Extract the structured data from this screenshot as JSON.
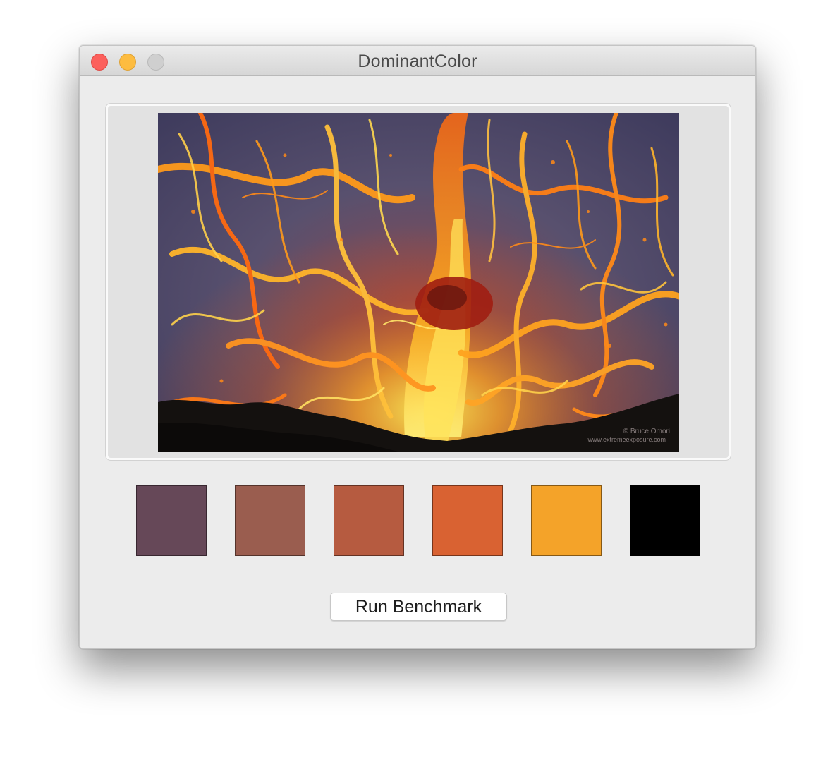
{
  "window": {
    "title": "DominantColor"
  },
  "image": {
    "credit_line1": "© Bruce Omori",
    "credit_line2": "www.extremeexposure.com"
  },
  "swatches": [
    {
      "color": "#664858"
    },
    {
      "color": "#9a5d4f"
    },
    {
      "color": "#b65b40"
    },
    {
      "color": "#d96232"
    },
    {
      "color": "#f4a329"
    },
    {
      "color": "#000000"
    }
  ],
  "actions": {
    "run_benchmark_label": "Run Benchmark"
  }
}
